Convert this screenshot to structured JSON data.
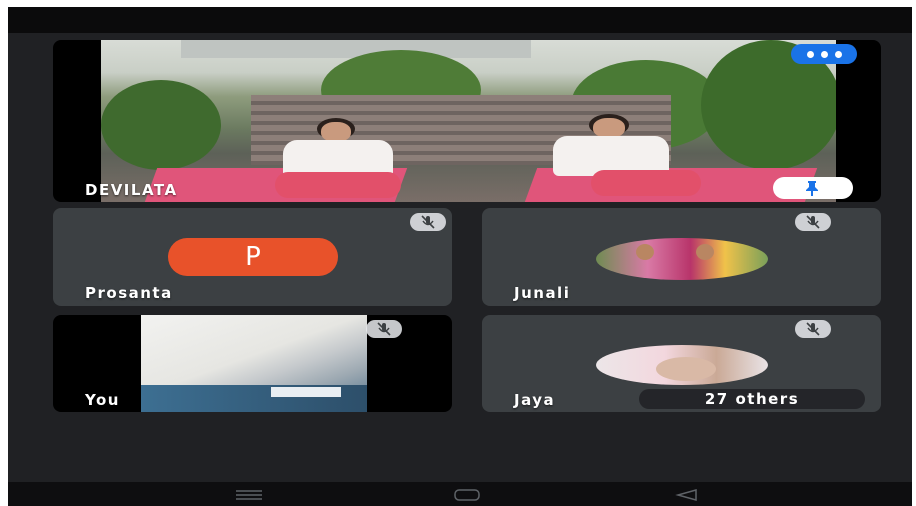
{
  "main_tile": {
    "name": "DEVILATA"
  },
  "participants": [
    {
      "name": "Prosanta",
      "avatar_letter": "P"
    },
    {
      "name": "Junali"
    },
    {
      "name": "You"
    },
    {
      "name": "Jaya"
    }
  ],
  "others_badge": "27 others",
  "colors": {
    "background": "#202124",
    "tile": "#3c4043",
    "accent_blue": "#1a73e8",
    "avatar_orange": "#e8522a"
  },
  "icons": {
    "more_options": "three-dots-icon",
    "pin": "pin-icon",
    "muted": "mic-off-icon",
    "nav_menu": "recent-apps-icon",
    "nav_home": "home-icon",
    "nav_back": "back-icon"
  }
}
